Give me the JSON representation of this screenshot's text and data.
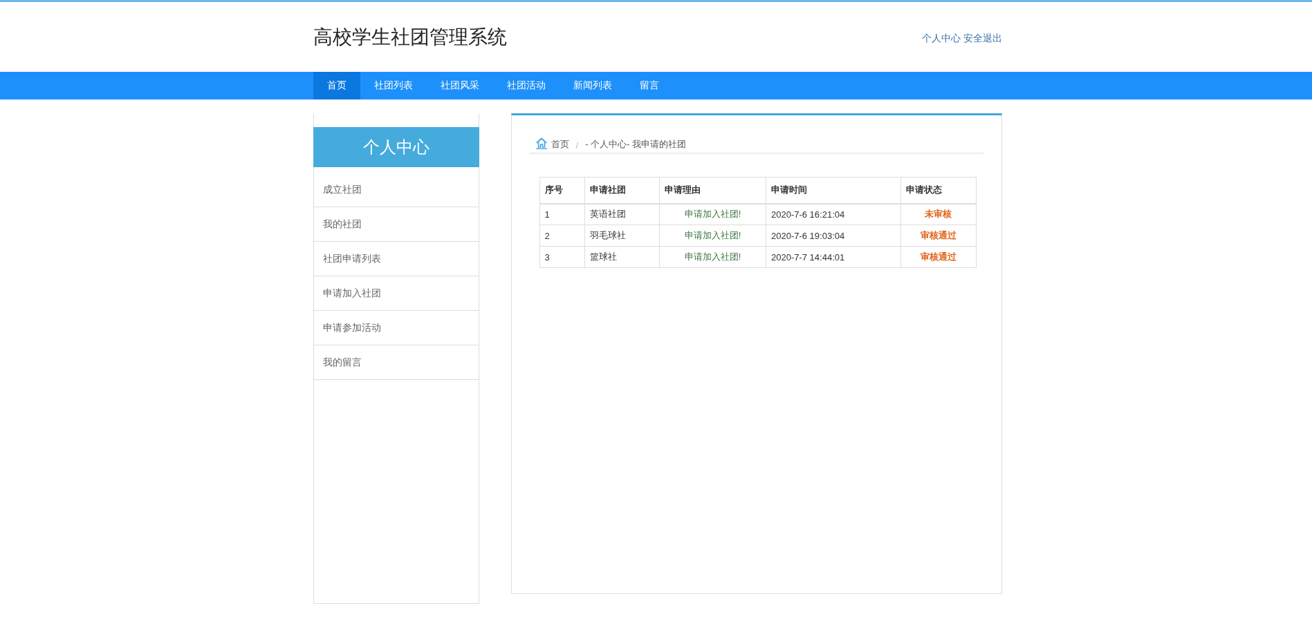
{
  "header": {
    "title": "高校学生社团管理系统",
    "links": [
      "个人中心",
      "安全退出"
    ]
  },
  "nav": [
    {
      "label": "首页",
      "selected": true
    },
    {
      "label": "社团列表",
      "selected": false
    },
    {
      "label": "社团风采",
      "selected": false
    },
    {
      "label": "社团活动",
      "selected": false
    },
    {
      "label": "新闻列表",
      "selected": false
    },
    {
      "label": "留言",
      "selected": false
    }
  ],
  "sidebar": {
    "title": "个人中心",
    "items": [
      "成立社团",
      "我的社团",
      "社团申请列表",
      "申请加入社团",
      "申请参加活动",
      "我的留言"
    ]
  },
  "breadcrumb": {
    "home": "首页",
    "separator": "/",
    "current": "- 个人中心- 我申请的社团"
  },
  "table": {
    "columns": [
      "序号",
      "申请社团",
      "申请理由",
      "申请时间",
      "申请状态"
    ],
    "rows": [
      {
        "index": "1",
        "club": "英语社团",
        "reason": "申请加入社团!",
        "time": "2020-7-6 16:21:04",
        "status": "未审核"
      },
      {
        "index": "2",
        "club": "羽毛球社",
        "reason": "申请加入社团!",
        "time": "2020-7-6 19:03:04",
        "status": "审核通过"
      },
      {
        "index": "3",
        "club": "篮球社",
        "reason": "申请加入社团!",
        "time": "2020-7-7 14:44:01",
        "status": "审核通过"
      }
    ]
  }
}
